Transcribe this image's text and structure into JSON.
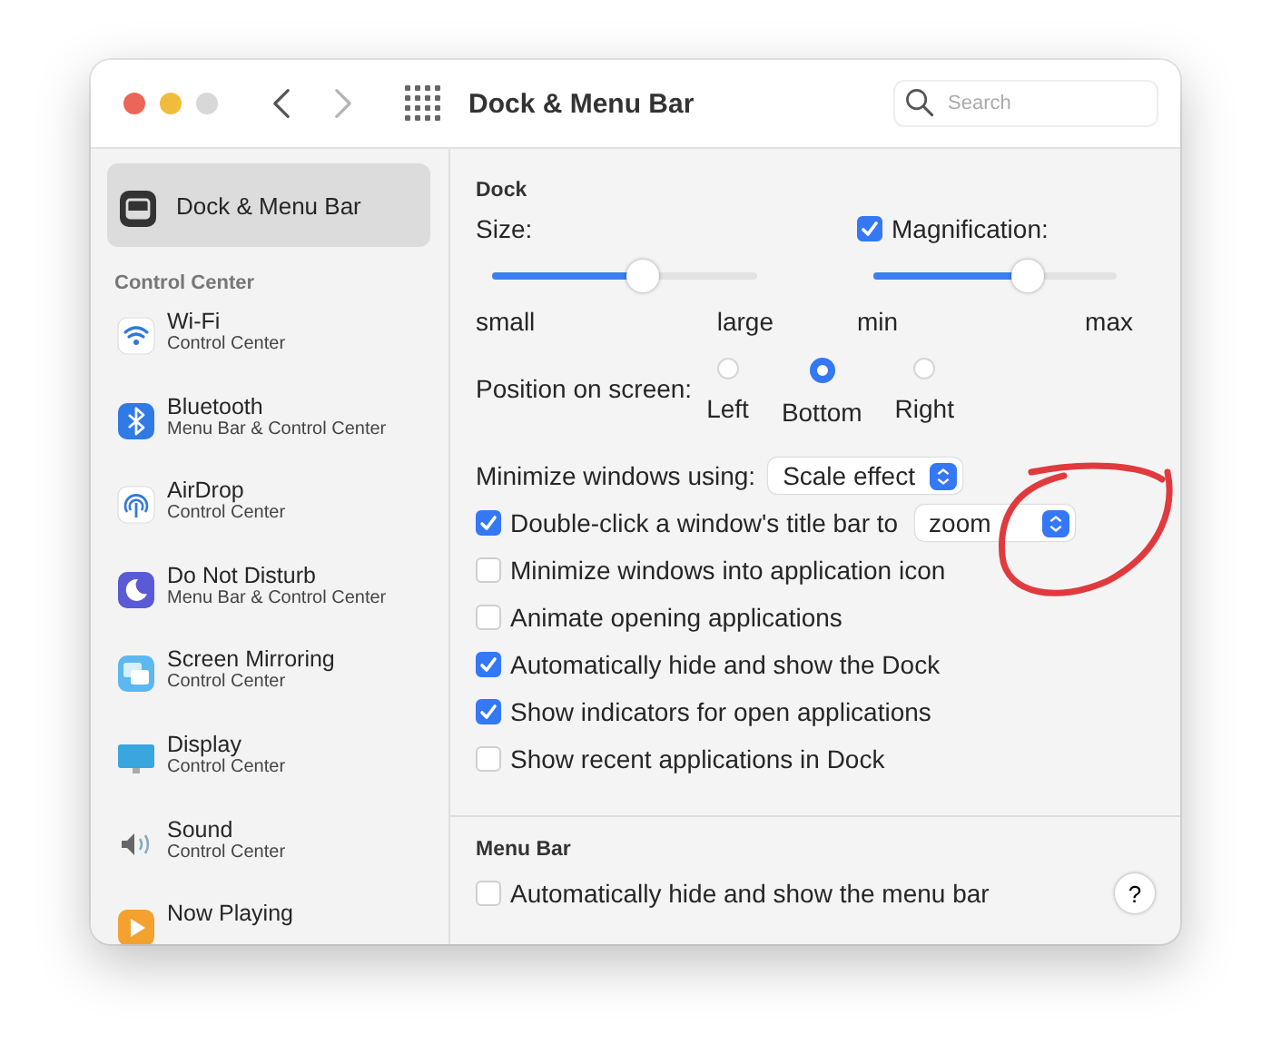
{
  "window": {
    "title": "Dock & Menu Bar",
    "traffic_lights": [
      {
        "kind": "close",
        "disabled": false
      },
      {
        "kind": "minimize",
        "disabled": false
      },
      {
        "kind": "zoom",
        "disabled": true
      }
    ],
    "nav": [
      {
        "kind": "back",
        "disabled": false
      },
      {
        "kind": "forward",
        "disabled": true
      }
    ],
    "search": {
      "placeholder": "Search"
    }
  },
  "sidebar": {
    "top_item": {
      "label": "Dock & Menu Bar",
      "selected": true
    },
    "section_title": "Control Center",
    "items": [
      {
        "kind": "wifi",
        "title": "Wi-Fi",
        "subtitle": "Control Center"
      },
      {
        "kind": "bluetooth",
        "title": "Bluetooth",
        "subtitle": "Menu Bar & Control Center"
      },
      {
        "kind": "airdrop",
        "title": "AirDrop",
        "subtitle": "Control Center"
      },
      {
        "kind": "moon",
        "title": "Do Not Disturb",
        "subtitle": "Menu Bar & Control Center"
      },
      {
        "kind": "mirroring",
        "title": "Screen Mirroring",
        "subtitle": "Control Center"
      },
      {
        "kind": "display",
        "title": "Display",
        "subtitle": "Control Center"
      },
      {
        "kind": "sound",
        "title": "Sound",
        "subtitle": "Control Center"
      },
      {
        "kind": "play",
        "title": "Now Playing"
      }
    ]
  },
  "dock": {
    "title": "Dock",
    "size": {
      "label": "Size:",
      "level": 0.56,
      "min_label": "small",
      "max_label": "large"
    },
    "magnification": {
      "label": "Magnification:",
      "checked": true,
      "level": 0.62,
      "min_label": "min",
      "max_label": "max"
    },
    "position": {
      "label": "Position on screen:",
      "options": [
        {
          "label": "Left",
          "selected": false
        },
        {
          "label": "Bottom",
          "selected": true
        },
        {
          "label": "Right",
          "selected": false
        }
      ]
    },
    "minimize_using": {
      "label": "Minimize windows using:",
      "value": "Scale effect"
    },
    "options": [
      {
        "kind": "select",
        "label": "Double-click a window's title bar to",
        "checked": true,
        "value": "zoom"
      },
      {
        "kind": "checkbox",
        "label": "Minimize windows into application icon",
        "checked": false
      },
      {
        "kind": "checkbox",
        "label": "Animate opening applications",
        "checked": false
      },
      {
        "kind": "checkbox",
        "label": "Automatically hide and show the Dock",
        "checked": true
      },
      {
        "kind": "checkbox",
        "label": "Show indicators for open applications",
        "checked": true
      },
      {
        "kind": "checkbox",
        "label": "Show recent applications in Dock",
        "checked": false
      }
    ]
  },
  "menu_bar": {
    "title": "Menu Bar",
    "options": [
      {
        "label": "Automatically hide and show the menu bar",
        "checked": false
      }
    ],
    "help": "?"
  }
}
